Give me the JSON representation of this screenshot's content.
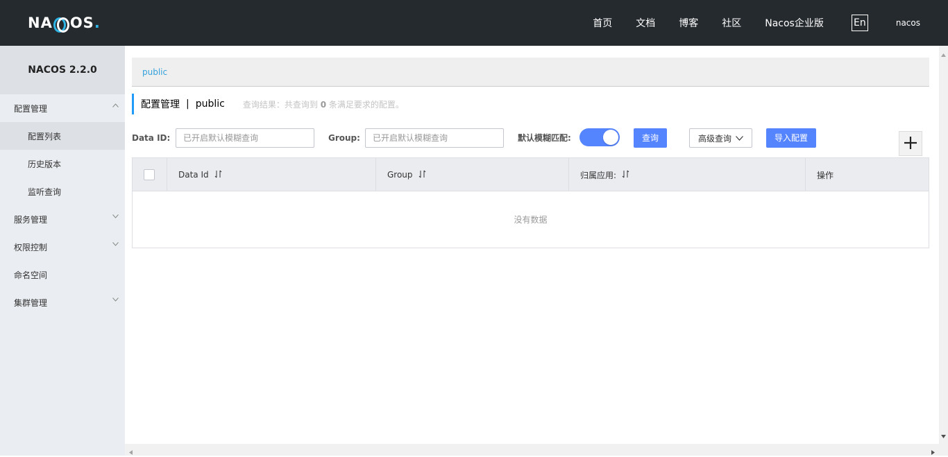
{
  "header": {
    "logo_text_a": "NA",
    "logo_text_b": "OS",
    "nav": [
      "首页",
      "文档",
      "博客",
      "社区",
      "Nacos企业版"
    ],
    "lang_label": "En",
    "user": "nacos"
  },
  "sidebar": {
    "title": "NACOS 2.2.0",
    "items": [
      {
        "label": "配置管理"
      },
      {
        "label": "配置列表"
      },
      {
        "label": "历史版本"
      },
      {
        "label": "监听查询"
      },
      {
        "label": "服务管理"
      },
      {
        "label": "权限控制"
      },
      {
        "label": "命名空间"
      },
      {
        "label": "集群管理"
      }
    ]
  },
  "namespace_bar": {
    "current": "public"
  },
  "heading": {
    "title": "配置管理",
    "separator": "|",
    "namespace": "public",
    "result_prefix": "查询结果：共查询到",
    "result_count": "0",
    "result_suffix": "条满足要求的配置。"
  },
  "filters": {
    "data_id_label": "Data ID:",
    "data_id_placeholder": "已开启默认模糊查询",
    "group_label": "Group:",
    "group_placeholder": "已开启默认模糊查询",
    "fuzzy_label": "默认模糊匹配:",
    "fuzzy_enabled": true,
    "search_button": "查询",
    "advanced_button": "高级查询",
    "import_button": "导入配置"
  },
  "table": {
    "columns": [
      "Data Id",
      "Group",
      "归属应用:",
      "操作"
    ],
    "empty_text": "没有数据"
  },
  "colors": {
    "header_bg": "#252a2f",
    "accent_blue": "#5584ff",
    "link_blue": "#33a1dc",
    "logo_cyan": "#2fb6e7"
  }
}
